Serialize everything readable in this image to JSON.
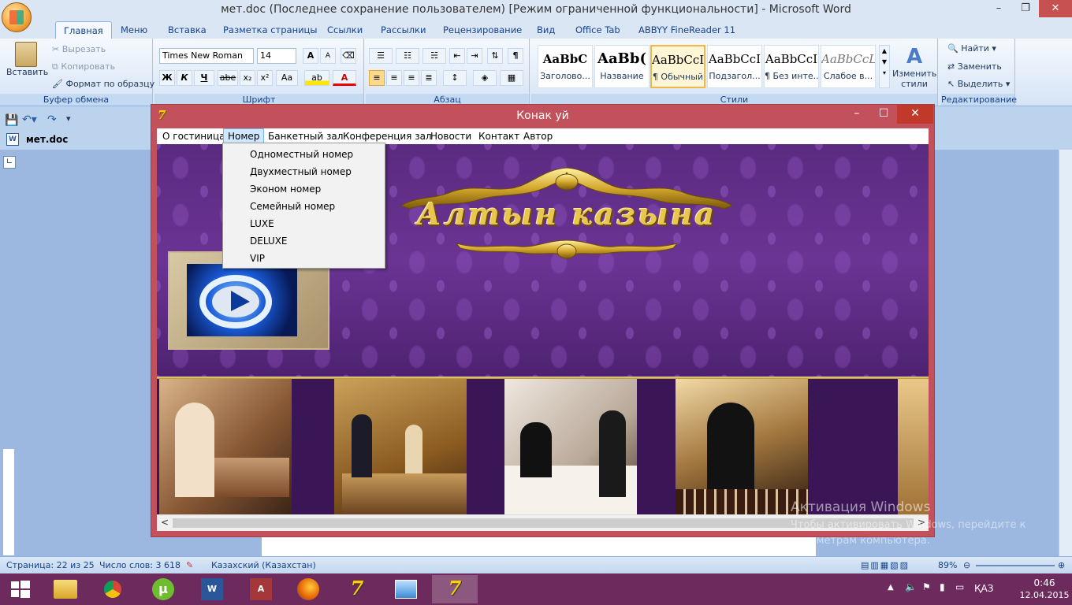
{
  "word": {
    "title": "мет.doc (Последнее сохранение пользователем) [Режим ограниченной функциональности] - Microsoft Word",
    "window_controls": {
      "minimize": "–",
      "restore": "❐",
      "close": "✕"
    },
    "tabs": [
      "Главная",
      "Меню",
      "Вставка",
      "Разметка страницы",
      "Ссылки",
      "Рассылки",
      "Рецензирование",
      "Вид",
      "Office Tab",
      "ABBYY FineReader 11"
    ],
    "clipboard": {
      "paste": "Вставить",
      "cut": "Вырезать",
      "copy": "Копировать",
      "format_painter": "Формат по образцу",
      "group": "Буфер обмена"
    },
    "font": {
      "name": "Times New Roman",
      "size": "14",
      "group": "Шрифт",
      "bold": "Ж",
      "italic": "К",
      "underline": "Ч",
      "strike": "abe",
      "sub": "x₂",
      "sup": "x²",
      "case": "Aa",
      "grow": "A",
      "shrink": "A"
    },
    "paragraph": {
      "group": "Абзац",
      "pilcrow": "¶"
    },
    "styles": {
      "group": "Стили",
      "items": [
        {
          "preview": "AaBbC",
          "name": "Заголово..."
        },
        {
          "preview": "AaBb(",
          "name": "Название"
        },
        {
          "preview": "AaBbCcI",
          "name": "¶ Обычный"
        },
        {
          "preview": "AaBbCcI",
          "name": "Подзагол..."
        },
        {
          "preview": "AaBbCcI",
          "name": "¶ Без инте..."
        },
        {
          "preview": "AaBbCcL",
          "name": "Слабое в..."
        }
      ],
      "change": "Изменить стили"
    },
    "editing": {
      "group": "Редактирование",
      "find": "Найти",
      "replace": "Заменить",
      "select": "Выделить"
    },
    "doc_tab": "мет.doc (Последнее...ункци",
    "status": {
      "page": "Страница: 22 из 25",
      "words": "Число слов: 3 618",
      "lang": "Казахский (Казахстан)",
      "zoom": "89%"
    }
  },
  "app": {
    "title": "Конак уй",
    "icon_text": "7",
    "window_controls": {
      "minimize": "–",
      "maximize": "☐",
      "close": "✕"
    },
    "menu": [
      "О гостиница",
      "Номер",
      "Банкетный зал",
      "Конференция зал",
      "Новости",
      "Контакт",
      "Автор"
    ],
    "dropdown": [
      "Одноместный номер",
      "Двухместный номер",
      "Эконом номер",
      "Семейный номер",
      "LUXE",
      "DELUXE",
      "VIP"
    ],
    "hotel_name": "Алтын казына",
    "scroll_left": "<",
    "scroll_right": ">"
  },
  "watermark": {
    "line1": "Активация Windows",
    "line2": "Чтобы активировать Windows, перейдите к параметрам компьютера."
  },
  "tray": {
    "lang": "ҚАЗ",
    "time": "0:46",
    "date": "12.04.2015"
  },
  "colors": {
    "app_frame": "#c2515b",
    "banner": "#5a2a80",
    "gold": "#e8c650",
    "taskbar": "#6d2a5c"
  }
}
